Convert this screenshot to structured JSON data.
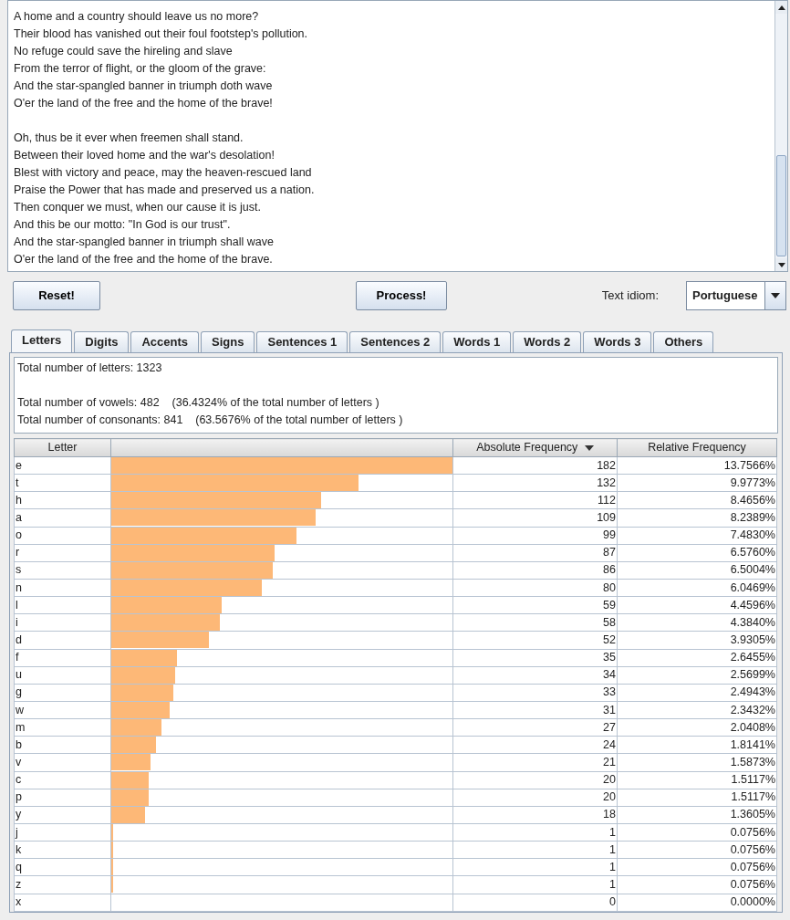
{
  "text_area": {
    "stanzas": [
      [
        "A home and a country should leave us no more?",
        "Their blood has vanished out their foul footstep's pollution.",
        "No refuge could save the hireling and slave",
        "From the terror of flight, or the gloom of the grave:",
        "And the star-spangled banner in triumph doth wave",
        "O'er the land of the free and the home of the brave!"
      ],
      [
        "Oh, thus be it ever when freemen shall stand.",
        "Between their loved home and the war's desolation!",
        "Blest with victory and peace, may the heaven-rescued land",
        "Praise the Power that has made and preserved us a nation.",
        "Then conquer we must, when our cause it is just.",
        "And this be our motto: \"In God is our trust\".",
        "And the star-spangled banner in triumph shall wave",
        "O'er the land of the free and the home of the brave."
      ]
    ]
  },
  "buttons": [
    "Reset!",
    "Process!"
  ],
  "idiom": {
    "label": "Text idiom:",
    "value": "Portuguese"
  },
  "tabs": [
    {
      "label": "Letters",
      "selected": true
    },
    {
      "label": "Digits",
      "selected": false
    },
    {
      "label": "Accents",
      "selected": false
    },
    {
      "label": "Signs",
      "selected": false
    },
    {
      "label": "Sentences 1",
      "selected": false
    },
    {
      "label": "Sentences 2",
      "selected": false
    },
    {
      "label": "Words 1",
      "selected": false
    },
    {
      "label": "Words 2",
      "selected": false
    },
    {
      "label": "Words 3",
      "selected": false
    },
    {
      "label": "Others",
      "selected": false
    }
  ],
  "summary": [
    [
      "Total number of letters: 1323"
    ],
    [
      "Total number of vowels: 482    (36.4324% of the total number of letters )",
      "Total number of consonants: 841    (63.5676% of the total number of letters )"
    ]
  ],
  "table": {
    "columns": [
      {
        "label": "Letter",
        "sorted": false
      },
      {
        "sorted": false
      },
      {
        "label": "Absolute Frequency",
        "sorted": true
      },
      {
        "label": "Relative Frequency",
        "sorted": false
      }
    ],
    "rows": [
      {
        "letter": "e",
        "level": 1,
        "absolute": "182",
        "relative": "13.7566%"
      },
      {
        "letter": "t",
        "level": 0.725,
        "absolute": "132",
        "relative": "9.9773%"
      },
      {
        "letter": "h",
        "level": 0.615,
        "absolute": "112",
        "relative": "8.4656%"
      },
      {
        "letter": "a",
        "level": 0.599,
        "absolute": "109",
        "relative": "8.2389%"
      },
      {
        "letter": "o",
        "level": 0.544,
        "absolute": "99",
        "relative": "7.4830%"
      },
      {
        "letter": "r",
        "level": 0.478,
        "absolute": "87",
        "relative": "6.5760%"
      },
      {
        "letter": "s",
        "level": 0.473,
        "absolute": "86",
        "relative": "6.5004%"
      },
      {
        "letter": "n",
        "level": 0.44,
        "absolute": "80",
        "relative": "6.0469%"
      },
      {
        "letter": "l",
        "level": 0.324,
        "absolute": "59",
        "relative": "4.4596%"
      },
      {
        "letter": "i",
        "level": 0.319,
        "absolute": "58",
        "relative": "4.3840%"
      },
      {
        "letter": "d",
        "level": 0.286,
        "absolute": "52",
        "relative": "3.9305%"
      },
      {
        "letter": "f",
        "level": 0.192,
        "absolute": "35",
        "relative": "2.6455%"
      },
      {
        "letter": "u",
        "level": 0.187,
        "absolute": "34",
        "relative": "2.5699%"
      },
      {
        "letter": "g",
        "level": 0.181,
        "absolute": "33",
        "relative": "2.4943%"
      },
      {
        "letter": "w",
        "level": 0.17,
        "absolute": "31",
        "relative": "2.3432%"
      },
      {
        "letter": "m",
        "level": 0.148,
        "absolute": "27",
        "relative": "2.0408%"
      },
      {
        "letter": "b",
        "level": 0.132,
        "absolute": "24",
        "relative": "1.8141%"
      },
      {
        "letter": "v",
        "level": 0.115,
        "absolute": "21",
        "relative": "1.5873%"
      },
      {
        "letter": "c",
        "level": 0.11,
        "absolute": "20",
        "relative": "1.5117%"
      },
      {
        "letter": "p",
        "level": 0.11,
        "absolute": "20",
        "relative": "1.5117%"
      },
      {
        "letter": "y",
        "level": 0.099,
        "absolute": "18",
        "relative": "1.3605%"
      },
      {
        "letter": "j",
        "level": 0.005,
        "absolute": "1",
        "relative": "0.0756%"
      },
      {
        "letter": "k",
        "level": 0.005,
        "absolute": "1",
        "relative": "0.0756%"
      },
      {
        "letter": "q",
        "level": 0.005,
        "absolute": "1",
        "relative": "0.0756%"
      },
      {
        "letter": "z",
        "level": 0.005,
        "absolute": "1",
        "relative": "0.0756%"
      },
      {
        "letter": "x",
        "absolute": "0",
        "relative": "0.0000%"
      }
    ]
  }
}
